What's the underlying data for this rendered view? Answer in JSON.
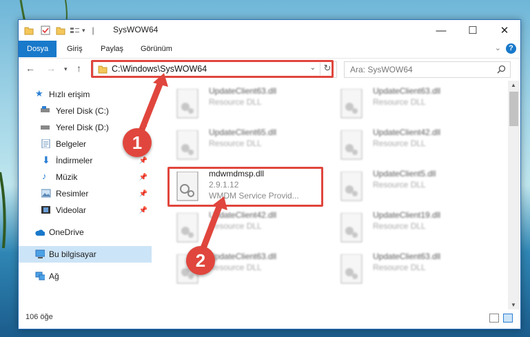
{
  "window": {
    "title": "SysWOW64",
    "controls": {
      "minimize": "—",
      "maximize": "☐",
      "close": "✕"
    }
  },
  "ribbon": {
    "tabs": [
      "Dosya",
      "Giriş",
      "Paylaş",
      "Görünüm"
    ],
    "help": "?"
  },
  "nav": {
    "address": "C:\\Windows\\SysWOW64",
    "search_placeholder": "Ara: SysWOW64"
  },
  "sidebar": {
    "items": [
      {
        "label": "Hızlı erişim",
        "icon": "star-icon"
      },
      {
        "label": "Yerel Disk (C:)",
        "icon": "drive-icon"
      },
      {
        "label": "Yerel Disk (D:)",
        "icon": "drive-icon"
      },
      {
        "label": "Belgeler",
        "icon": "documents-icon"
      },
      {
        "label": "İndirmeler",
        "icon": "download-icon"
      },
      {
        "label": "Müzik",
        "icon": "music-icon"
      },
      {
        "label": "Resimler",
        "icon": "pictures-icon"
      },
      {
        "label": "Videolar",
        "icon": "videos-icon"
      },
      {
        "label": "OneDrive",
        "icon": "cloud-icon"
      },
      {
        "label": "Bu bilgisayar",
        "icon": "computer-icon"
      },
      {
        "label": "Ağ",
        "icon": "network-icon"
      }
    ]
  },
  "files": [
    {
      "name": "UpdateClient63.dll",
      "line2": "Resource DLL",
      "line3": ""
    },
    {
      "name": "UpdateClient63.dll",
      "line2": "Resource DLL",
      "line3": ""
    },
    {
      "name": "UpdateClient65.dll",
      "line2": "Resource DLL",
      "line3": ""
    },
    {
      "name": "UpdateClient42.dll",
      "line2": "Resource DLL",
      "line3": ""
    },
    {
      "name": "mdwmdmsp.dll",
      "line2": "2.9.1.12",
      "line3": "WMDM Service Provid..."
    },
    {
      "name": "UpdateClient5.dll",
      "line2": "Resource DLL",
      "line3": ""
    },
    {
      "name": "UpdateClient42.dll",
      "line2": "Resource DLL",
      "line3": ""
    },
    {
      "name": "UpdateClient19.dll",
      "line2": "Resource DLL",
      "line3": ""
    },
    {
      "name": "UpdateClient63.dll",
      "line2": "Resource DLL",
      "line3": ""
    },
    {
      "name": "UpdateClient63.dll",
      "line2": "Resource DLL",
      "line3": ""
    }
  ],
  "status": {
    "count": "106 öğe"
  },
  "markers": {
    "one": "1",
    "two": "2"
  },
  "colors": {
    "accent": "#1979ca",
    "highlight": "#e0463d"
  }
}
